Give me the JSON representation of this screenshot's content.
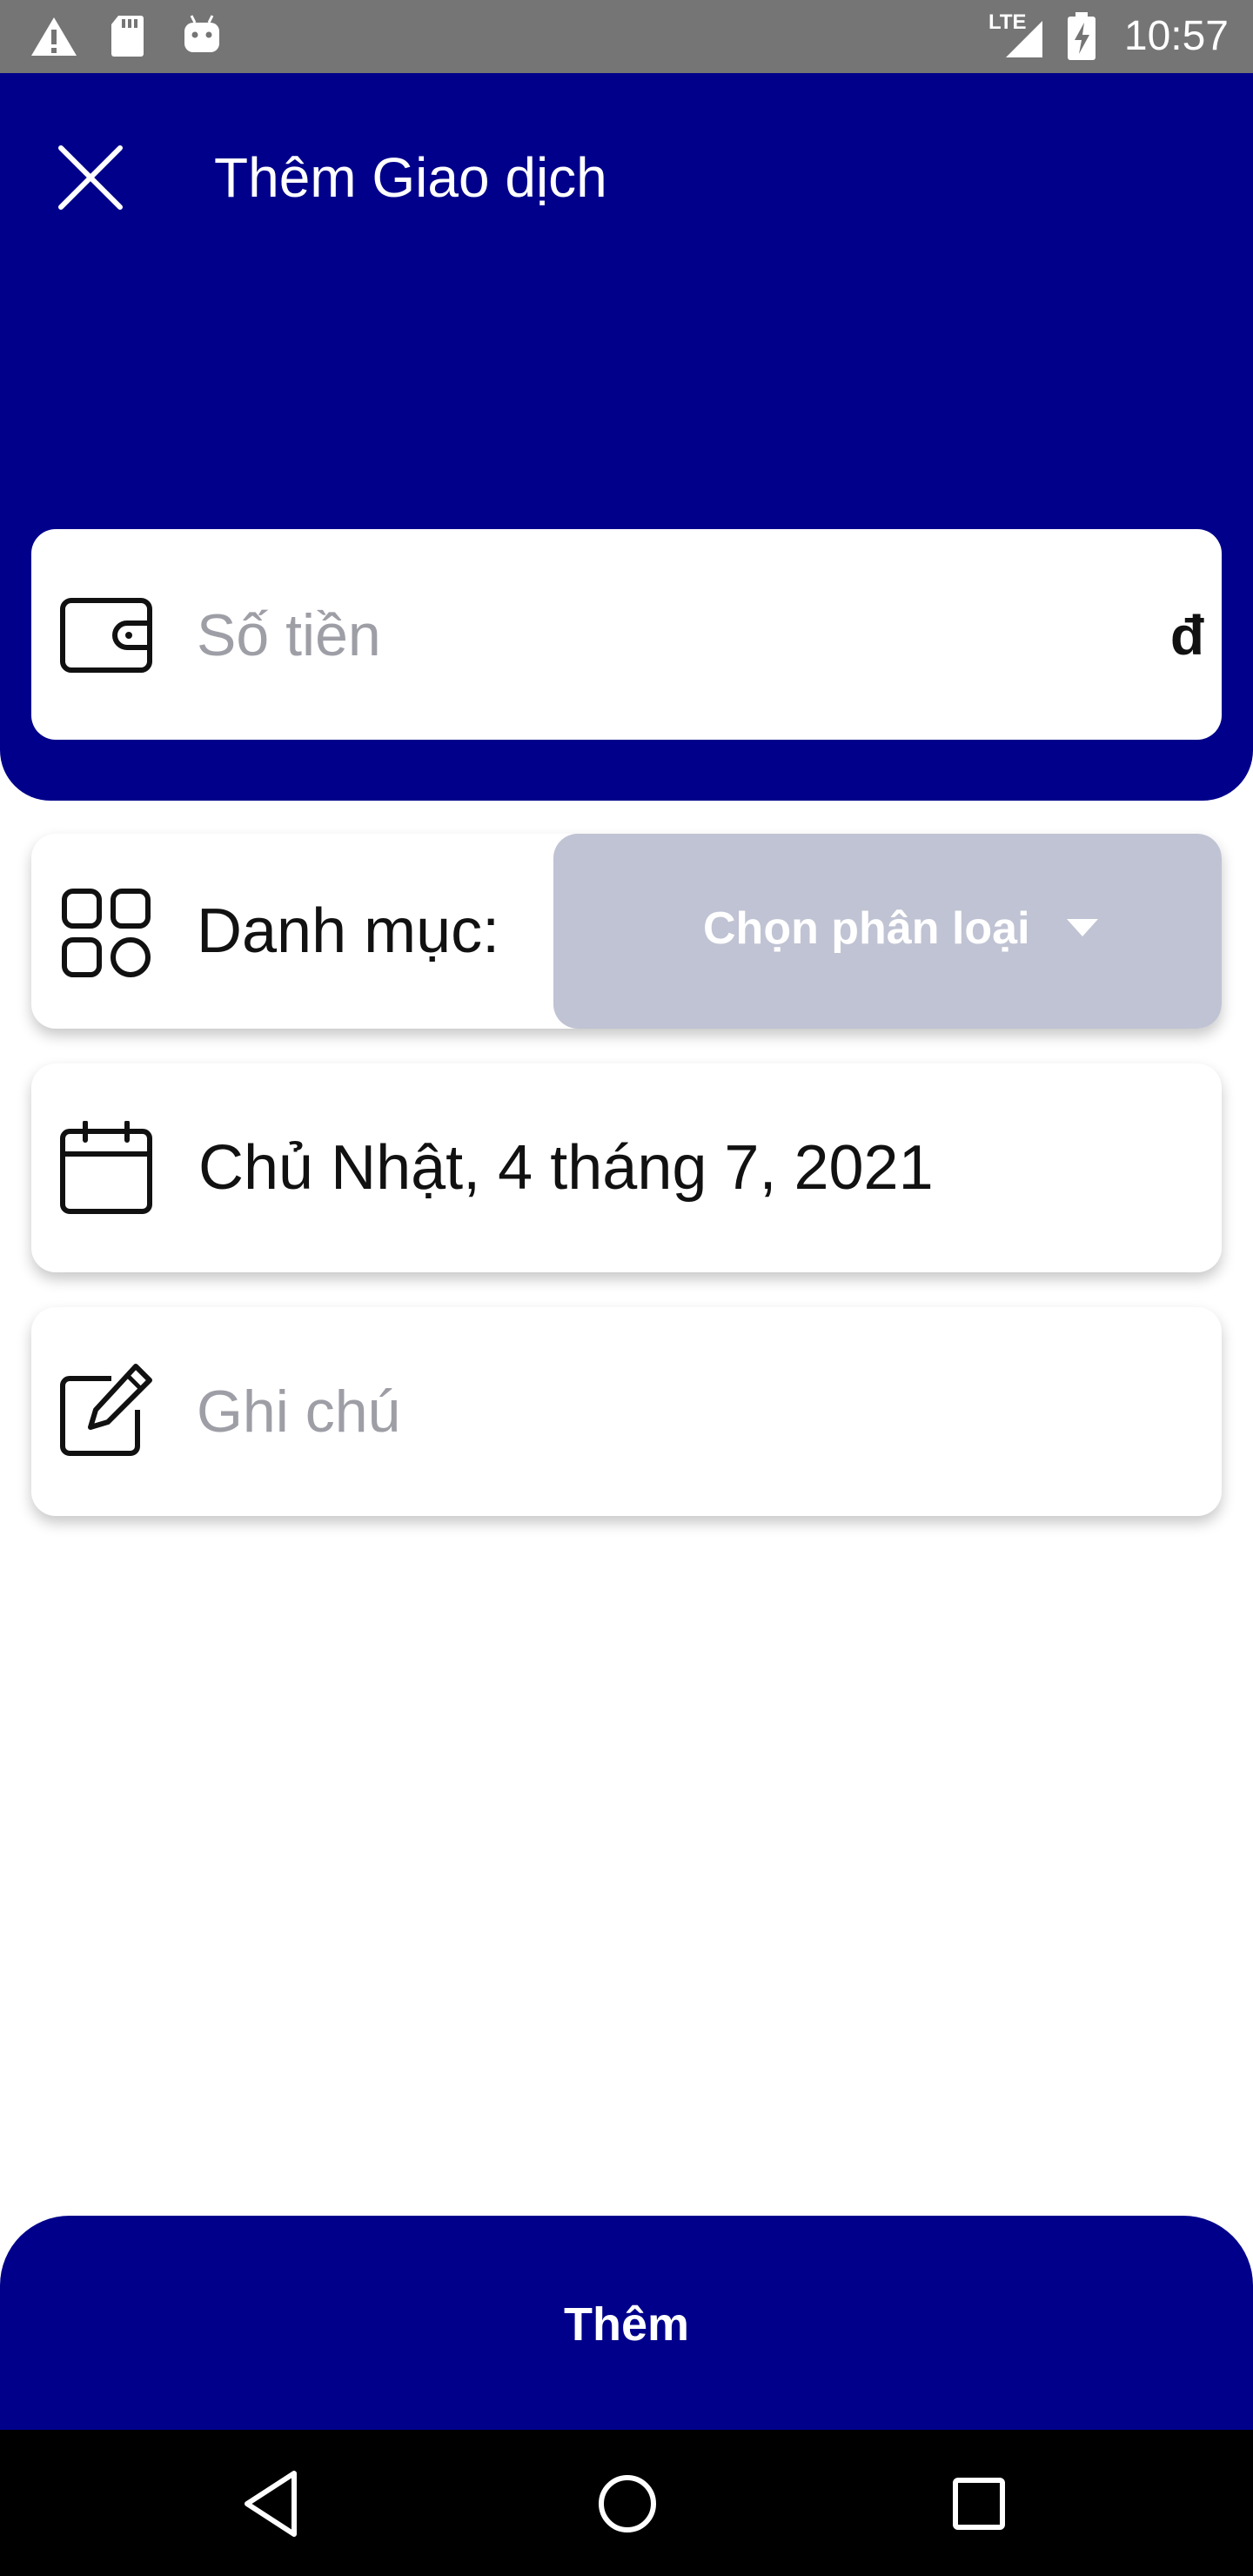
{
  "status_bar": {
    "time": "10:57",
    "network": "LTE",
    "icons": [
      "warning-icon",
      "sd-card-icon",
      "android-icon",
      "signal-icon",
      "battery-charging-icon"
    ]
  },
  "header": {
    "title": "Thêm Giao dịch",
    "close_icon": "close-icon",
    "color": "#00008B"
  },
  "amount": {
    "placeholder": "Số tiền",
    "currency": "đ",
    "icon": "wallet-icon"
  },
  "category": {
    "label": "Danh mục:",
    "select_text": "Chọn phân loại",
    "icon": "grid-icon"
  },
  "date": {
    "value": "Chủ Nhật, 4 tháng 7, 2021",
    "icon": "calendar-icon"
  },
  "note": {
    "placeholder": "Ghi chú",
    "icon": "edit-icon"
  },
  "submit": {
    "label": "Thêm"
  },
  "nav": {
    "buttons": [
      "back-icon",
      "home-icon",
      "recents-icon"
    ]
  }
}
